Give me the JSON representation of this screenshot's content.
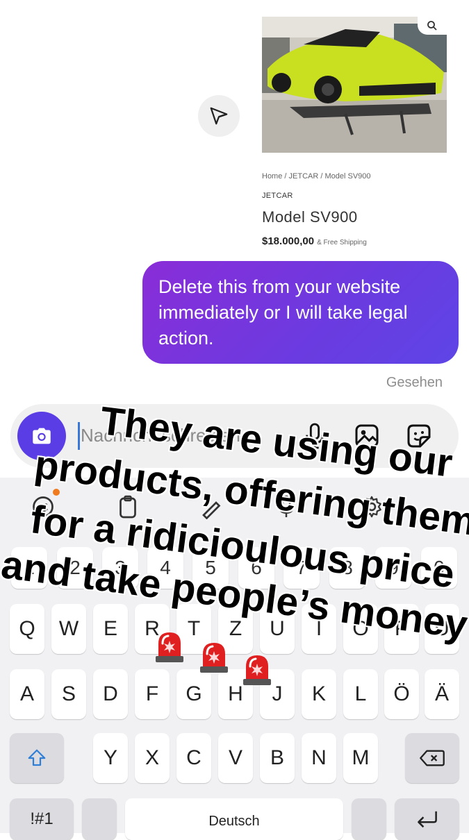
{
  "chat": {
    "product": {
      "breadcrumb": "Home / JETCAR / Model SV900",
      "brand": "JETCAR",
      "title": "Model SV900",
      "price": "$18.000,00",
      "shipping": "& Free Shipping"
    },
    "message": "Delete this from your website immediately or I will take legal action.",
    "status": "Gesehen"
  },
  "composer": {
    "placeholder": "Nachricht schreiben ..."
  },
  "keyboard": {
    "number_row": [
      "1",
      "2",
      "3",
      "4",
      "5",
      "6",
      "7",
      "8",
      "9",
      "0"
    ],
    "row1": [
      "Q",
      "W",
      "E",
      "R",
      "T",
      "Z",
      "U",
      "I",
      "O",
      "P",
      "Ü"
    ],
    "row2": [
      "A",
      "S",
      "D",
      "F",
      "G",
      "H",
      "J",
      "K",
      "L",
      "Ö",
      "Ä"
    ],
    "row3": [
      "Y",
      "X",
      "C",
      "V",
      "B",
      "N",
      "M"
    ],
    "symbols_label": "!#1",
    "space_label": "Deutsch",
    "more_label": "..."
  },
  "overlay": {
    "lines": [
      "They are using our",
      "products, offering them",
      "for a ridicioulous price",
      "and take people’s money"
    ]
  },
  "colors": {
    "accent": "#5b3de6",
    "bubble_start": "#8a2dd8",
    "bubble_end": "#5e45e6",
    "siren": "#e02020"
  }
}
